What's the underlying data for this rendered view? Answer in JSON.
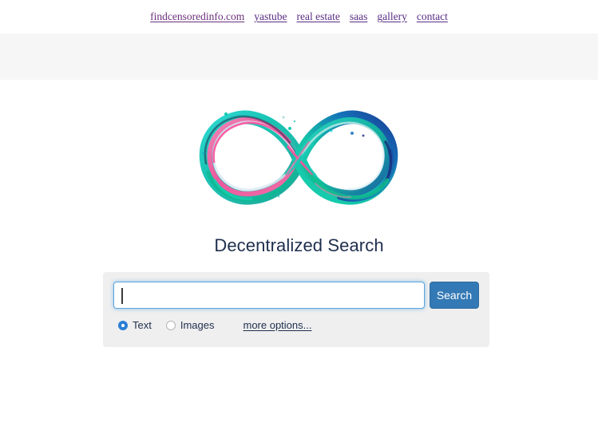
{
  "nav": {
    "links": [
      {
        "label": "findcensoredinfo.com",
        "name": "nav-link-findcensoredinfo"
      },
      {
        "label": "yastube",
        "name": "nav-link-yastube"
      },
      {
        "label": "real estate",
        "name": "nav-link-real-estate"
      },
      {
        "label": "saas",
        "name": "nav-link-saas"
      },
      {
        "label": "gallery",
        "name": "nav-link-gallery"
      },
      {
        "label": "contact",
        "name": "nav-link-contact"
      }
    ],
    "link_color": "#5a2d82"
  },
  "header_band": {
    "background": "#f6f6f6"
  },
  "logo": {
    "icon": "infinity-paint-splash-logo",
    "colors": {
      "teal": "#17c1b0",
      "cyan": "#2fd8d0",
      "pink": "#ff5fa2",
      "navy": "#1b3a8c",
      "green": "#0fbf86",
      "light": "#d8e6ef"
    }
  },
  "title": {
    "text": "Decentralized Search",
    "color": "#1f2f4d"
  },
  "search": {
    "input_value": "",
    "placeholder": "",
    "button_label": "Search",
    "button_color": "#3379b5",
    "focus_border_color": "#5ba4dd",
    "panel_background": "#efefef",
    "options": [
      {
        "label": "Text",
        "selected": true,
        "name": "radio-text"
      },
      {
        "label": "Images",
        "selected": false,
        "name": "radio-images"
      }
    ],
    "more_options_label": "more options..."
  }
}
